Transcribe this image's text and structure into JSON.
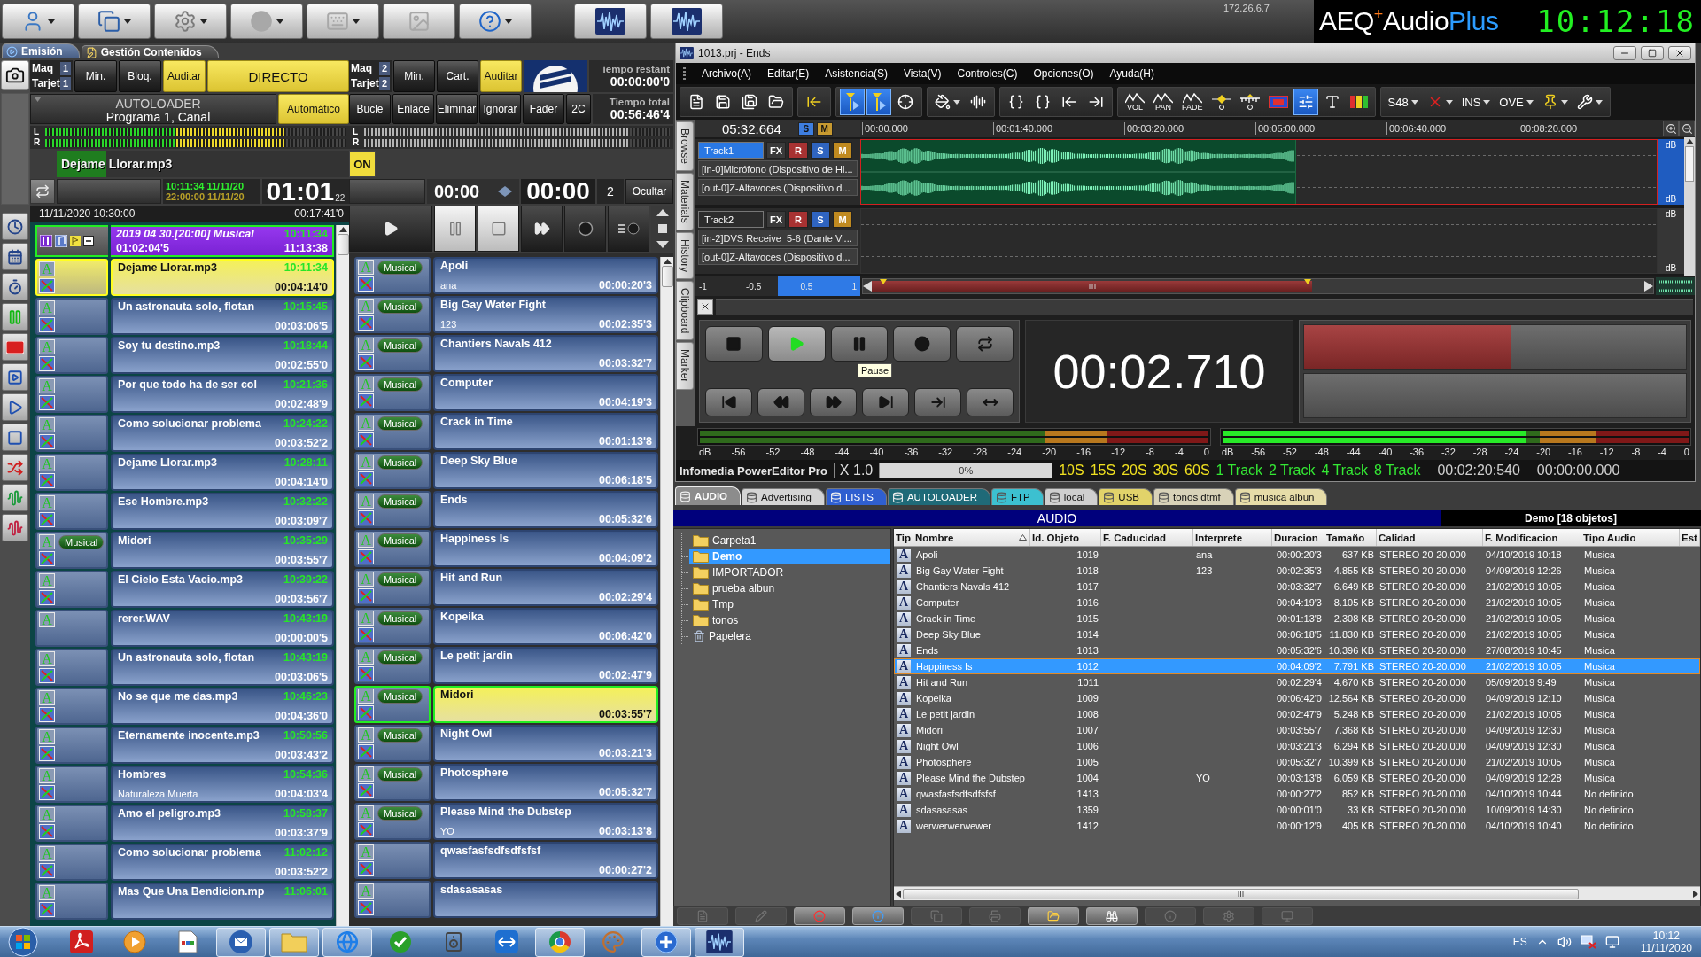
{
  "top_bar": {
    "buttons": [
      {
        "kind": "user",
        "disabled": false
      },
      {
        "kind": "windows",
        "disabled": false
      },
      {
        "kind": "gear",
        "disabled": false
      },
      {
        "kind": "disc",
        "disabled": true
      },
      {
        "kind": "grid",
        "disabled": true
      },
      {
        "kind": "figures",
        "disabled": true
      },
      {
        "kind": "help",
        "disabled": false
      }
    ],
    "ip_address": "172.26.6.7",
    "logo": {
      "company": "AEQ",
      "plus": "+",
      "product": "Audio",
      "edition": "Plus"
    },
    "clock": "10:12:18"
  },
  "main_tabs": [
    {
      "label": "Emisión",
      "selected": true
    },
    {
      "label": "Gestión Contenidos",
      "selected": false
    }
  ],
  "player_1": {
    "machine_label": "Maq",
    "machine": "1",
    "card_label": "Tarjet",
    "card": "1",
    "buttons": [
      {
        "label": "Min.",
        "on": false
      },
      {
        "label": "Bloq.",
        "on": false
      },
      {
        "label": "Auditar",
        "on": true
      },
      {
        "label": "DIRECTO",
        "on": true
      }
    ],
    "source": {
      "title": "AUTOLOADER",
      "subtitle": "Programa 1, Canal"
    },
    "mode": {
      "label": "Automático",
      "on": true
    },
    "meters": [
      {
        "channel": "L",
        "level": 0.8,
        "active": true
      },
      {
        "channel": "R",
        "level": 0.8,
        "active": true
      }
    ],
    "now_playing": {
      "title": "Dejame Llorar.mp3",
      "level": 0.17
    },
    "clock_start": "10:11:34 11/11/20",
    "clock_end": "22:00:00 11/11/20",
    "countdown": "01:01",
    "countdown_fraction": "22",
    "list_date": "11/11/2020 10:30:00",
    "list_total": "00:17:41'0",
    "block": {
      "title": "2019 04 30.[20:00] Musical",
      "start": "10:11:34",
      "length": "01:02:04'5",
      "end": "11:13:38"
    },
    "items": [
      {
        "type": "A",
        "title": "Dejame Llorar.mp3",
        "time": "10:11:34",
        "duration": "00:04:14'0",
        "transition": true,
        "selected": true
      },
      {
        "type": "A",
        "title": "Un astronauta solo, flotan",
        "time": "10:15:45",
        "duration": "00:03:06'5",
        "transition": true,
        "selected": false
      },
      {
        "type": "A",
        "title": "Soy tu destino.mp3",
        "time": "10:18:44",
        "duration": "00:02:55'0",
        "transition": true,
        "selected": false
      },
      {
        "type": "A",
        "title": "Por que todo ha de ser col",
        "time": "10:21:36",
        "duration": "00:02:48'9",
        "transition": true,
        "selected": false
      },
      {
        "type": "A",
        "title": "Como solucionar problema",
        "time": "10:24:22",
        "duration": "00:03:52'2",
        "transition": true,
        "selected": false
      },
      {
        "type": "A",
        "title": "Dejame Llorar.mp3",
        "time": "10:28:11",
        "duration": "00:04:14'0",
        "transition": true,
        "selected": false
      },
      {
        "type": "A",
        "title": "Ese Hombre.mp3",
        "time": "10:32:22",
        "duration": "00:03:09'7",
        "transition": true,
        "selected": false
      },
      {
        "type": "A",
        "title": "Midori",
        "tag": "Musical",
        "time": "10:35:29",
        "duration": "00:03:55'7",
        "transition": true,
        "selected": false
      },
      {
        "type": "A",
        "title": "El Cielo Esta Vacio.mp3",
        "time": "10:39:22",
        "duration": "00:03:56'7",
        "transition": true,
        "selected": false
      },
      {
        "type": "A",
        "title": "rerer.WAV",
        "time": "10:43:19",
        "duration": "00:00:00'5",
        "transition": false,
        "selected": false
      },
      {
        "type": "A",
        "title": "Un astronauta solo, flotan",
        "time": "10:43:19",
        "duration": "00:03:06'5",
        "transition": true,
        "selected": false
      },
      {
        "type": "A",
        "title": "No se que me das.mp3",
        "time": "10:46:23",
        "duration": "00:04:36'0",
        "transition": true,
        "selected": false
      },
      {
        "type": "A",
        "title": "Eternamente inocente.mp3",
        "time": "10:50:56",
        "duration": "00:03:43'2",
        "transition": true,
        "selected": false
      },
      {
        "type": "A",
        "title": "Hombres",
        "subtitle": "Naturaleza Muerta",
        "time": "10:54:36",
        "duration": "00:04:03'4",
        "transition": true,
        "selected": false
      },
      {
        "type": "A",
        "title": "Amo el peligro.mp3",
        "time": "10:58:37",
        "duration": "00:03:37'9",
        "transition": true,
        "selected": false
      },
      {
        "type": "A",
        "title": "Como solucionar problema",
        "time": "11:02:12",
        "duration": "00:03:52'2",
        "transition": true,
        "selected": false
      },
      {
        "type": "A",
        "title": "Mas Que Una Bendicion.mp",
        "time": "11:06:01",
        "transition": true,
        "selected": false
      }
    ]
  },
  "player_2": {
    "machine_label": "Maq",
    "machine": "2",
    "card_label": "Tarjet",
    "card": "2",
    "buttons": [
      {
        "label": "Min.",
        "on": false
      },
      {
        "label": "Cart.",
        "on": false
      },
      {
        "label": "Auditar",
        "on": true
      }
    ],
    "remaining_label": "iempo restant",
    "remaining": "00:00:00'0",
    "options": [
      {
        "label": "Bucle",
        "on": false
      },
      {
        "label": "Enlace",
        "on": false
      },
      {
        "label": "Eliminar",
        "on": false
      },
      {
        "label": "Ignorar",
        "on": false
      },
      {
        "label": "Fader",
        "on": false
      },
      {
        "label": "2C",
        "on": false
      }
    ],
    "total_label": "Tiempo total",
    "total": "00:56:46'4",
    "meters": [
      {
        "channel": "L",
        "level": 0.87,
        "active": false
      },
      {
        "channel": "R",
        "level": 0.87,
        "active": false
      }
    ],
    "on_air": {
      "label": "ON",
      "on": true
    },
    "position": "00:00",
    "remaining_time": "00:00",
    "count": "2",
    "hide_label": "Ocultar",
    "transport": [
      {
        "kind": "play",
        "on": false
      },
      {
        "kind": "pause",
        "on": true
      },
      {
        "kind": "stop",
        "on": true
      },
      {
        "kind": "forward",
        "on": false
      },
      {
        "kind": "record",
        "on": false
      },
      {
        "kind": "cue_record",
        "on": false
      }
    ],
    "items": [
      {
        "type": "A",
        "tag": "Musical",
        "title": "Apoli",
        "subtitle": "ana",
        "duration": "00:00:20'3",
        "transition": true,
        "selected": false
      },
      {
        "type": "A",
        "tag": "Musical",
        "title": "Big Gay Water Fight",
        "subtitle": "123",
        "duration": "00:02:35'3",
        "transition": true,
        "selected": false
      },
      {
        "type": "A",
        "tag": "Musical",
        "title": "Chantiers Navals 412",
        "duration": "00:03:32'7",
        "transition": true,
        "selected": false
      },
      {
        "type": "A",
        "tag": "Musical",
        "title": "Computer",
        "duration": "00:04:19'3",
        "transition": true,
        "selected": false
      },
      {
        "type": "A",
        "tag": "Musical",
        "title": "Crack in Time",
        "duration": "00:01:13'8",
        "transition": true,
        "selected": false
      },
      {
        "type": "A",
        "tag": "Musical",
        "title": "Deep Sky Blue",
        "duration": "00:06:18'5",
        "transition": true,
        "selected": false
      },
      {
        "type": "A",
        "tag": "Musical",
        "title": "Ends",
        "duration": "00:05:32'6",
        "transition": true,
        "selected": false
      },
      {
        "type": "A",
        "tag": "Musical",
        "title": "Happiness Is",
        "duration": "00:04:09'2",
        "transition": true,
        "selected": false
      },
      {
        "type": "A",
        "tag": "Musical",
        "title": "Hit and Run",
        "duration": "00:02:29'4",
        "transition": true,
        "selected": false
      },
      {
        "type": "A",
        "tag": "Musical",
        "title": "Kopeika",
        "duration": "00:06:42'0",
        "transition": true,
        "selected": false
      },
      {
        "type": "A",
        "tag": "Musical",
        "title": "Le petit jardin",
        "duration": "00:02:47'9",
        "transition": true,
        "selected": false
      },
      {
        "type": "A",
        "tag": "Musical",
        "title": "Midori",
        "duration": "00:03:55'7",
        "transition": true,
        "selected": true
      },
      {
        "type": "A",
        "tag": "Musical",
        "title": "Night Owl",
        "duration": "00:03:21'3",
        "transition": true,
        "selected": false
      },
      {
        "type": "A",
        "tag": "Musical",
        "title": "Photosphere",
        "duration": "00:05:32'7",
        "transition": true,
        "selected": false
      },
      {
        "type": "A",
        "tag": "Musical",
        "title": "Please Mind the Dubstep",
        "subtitle": "YO",
        "duration": "00:03:13'8",
        "transition": true,
        "selected": false
      },
      {
        "type": "A",
        "title": "qwasfasfsdfsdfsfsf",
        "duration": "00:00:27'2",
        "transition": true,
        "selected": false
      },
      {
        "type": "A",
        "title": "sdasasasas",
        "transition": true,
        "selected": false
      }
    ]
  },
  "editor": {
    "title": "1013.prj - Ends",
    "menu": [
      "Archivo(A)",
      "Editar(E)",
      "Asistencia(S)",
      "Vista(V)",
      "Controles(C)",
      "Opciones(O)",
      "Ayuda(H)"
    ],
    "toolbar": [
      [
        {
          "kind": "new",
          "selected": false
        },
        {
          "kind": "save",
          "selected": false
        },
        {
          "kind": "save_all",
          "selected": false
        },
        {
          "kind": "open",
          "selected": false
        }
      ],
      [
        {
          "kind": "insert",
          "selected": false
        }
      ],
      [
        {
          "kind": "mark_start",
          "selected": true
        },
        {
          "kind": "mark_end",
          "selected": true
        },
        {
          "kind": "move",
          "selected": false
        }
      ],
      [
        {
          "kind": "fill",
          "selected": false
        },
        {
          "kind": "normalize",
          "selected": false
        }
      ],
      [
        {
          "kind": "brace_left",
          "selected": false
        },
        {
          "kind": "brace_right",
          "selected": false
        },
        {
          "kind": "jump_left",
          "selected": false
        },
        {
          "kind": "jump_right",
          "selected": false
        }
      ],
      [
        {
          "kind": "envelope",
          "label": "VOL",
          "selected": false
        },
        {
          "kind": "envelope",
          "label": "PAN",
          "selected": false
        },
        {
          "kind": "envelope",
          "label": "FADE",
          "selected": false
        },
        {
          "kind": "gain_point",
          "selected": false
        },
        {
          "kind": "gain_ruler",
          "selected": false
        },
        {
          "kind": "region",
          "selected": false
        },
        {
          "kind": "slider",
          "selected": true
        },
        {
          "kind": "text",
          "selected": false
        },
        {
          "kind": "level_bars",
          "selected": false
        }
      ],
      [
        {
          "kind": "dropdown",
          "label": "S48",
          "selected": false
        },
        {
          "kind": "cut",
          "selected": false
        },
        {
          "kind": "dropdown",
          "label": "INS",
          "selected": false
        },
        {
          "kind": "dropdown",
          "label": "OVE",
          "selected": false
        },
        {
          "kind": "marker",
          "selected": false
        },
        {
          "kind": "wrench",
          "selected": false
        }
      ]
    ],
    "position": "05:32.664",
    "solo_label": "S",
    "mute_label": "M",
    "ruler": [
      "00:00.000",
      "00:01:40.000",
      "00:03:20.000",
      "00:05:00.000",
      "00:06:40.000",
      "00:08:20.000"
    ],
    "side_tabs": [
      "Browse",
      "Materials",
      "History",
      "Clipboard",
      "Marker"
    ],
    "tracks": [
      {
        "name": "Track1",
        "selected": true,
        "buttons": [
          {
            "kind": "fx",
            "label": "FX"
          },
          {
            "kind": "record",
            "label": "R"
          },
          {
            "kind": "solo",
            "label": "S"
          },
          {
            "kind": "mute",
            "label": "M"
          }
        ],
        "input": "[in-0]Micrófono (Dispositivo de Hi...",
        "output": "[out-0]Z-Altavoces (Dispositivo d...",
        "scale": [
          "dB",
          "dB"
        ],
        "clip": true
      },
      {
        "name": "Track2",
        "selected": false,
        "buttons": [
          {
            "kind": "fx",
            "label": "FX"
          },
          {
            "kind": "record",
            "label": "R"
          },
          {
            "kind": "solo",
            "label": "S"
          },
          {
            "kind": "mute",
            "label": "M"
          }
        ],
        "input": "[in-2]DVS Receive  5-6 (Dante Vi...",
        "output": "[out-0]Z-Altavoces (Dispositivo d...",
        "scale": [
          "dB",
          "dB"
        ],
        "clip": false
      }
    ],
    "zoom_scale": [
      "-1",
      "-0.5",
      "0.5",
      "1"
    ],
    "transport_top": [
      {
        "kind": "stop",
        "on": false
      },
      {
        "kind": "play",
        "on": true
      },
      {
        "kind": "pause",
        "on": false
      },
      {
        "kind": "record",
        "on": false
      },
      {
        "kind": "loop",
        "on": false
      }
    ],
    "transport_bottom": [
      {
        "kind": "start",
        "on": false
      },
      {
        "kind": "rewind",
        "on": false
      },
      {
        "kind": "forward",
        "on": false
      },
      {
        "kind": "end",
        "on": false
      },
      {
        "kind": "in_out",
        "on": false
      },
      {
        "kind": "span",
        "on": false
      }
    ],
    "tooltip": "Pause",
    "time": "00:02.710",
    "output_levels": [
      {
        "level": 0.54
      },
      {
        "level": 0
      }
    ],
    "meters": [
      {
        "channels": [
          {
            "level": 0
          },
          {
            "level": 0
          }
        ],
        "scale": [
          "dB",
          "-56",
          "-52",
          "-48",
          "-44",
          "-40",
          "-36",
          "-32",
          "-28",
          "-24",
          "-20",
          "-16",
          "-12",
          "-8",
          "-4",
          "0"
        ]
      },
      {
        "channels": [
          {
            "level": 0.65
          },
          {
            "level": 0.65
          }
        ],
        "scale": [
          "dB",
          "-56",
          "-52",
          "-48",
          "-44",
          "-40",
          "-36",
          "-32",
          "-28",
          "-24",
          "-20",
          "-16",
          "-12",
          "-8",
          "-4",
          "0"
        ]
      }
    ],
    "status": {
      "app": "Infomedia PowerEditor Pro",
      "zoom": "X 1.0",
      "progress": {
        "label": "0%",
        "level": 0
      },
      "spans": [
        "10S",
        "15S",
        "20S",
        "30S",
        "60S"
      ],
      "track_modes": [
        "1 Track",
        "2 Track",
        "4 Track",
        "8 Track"
      ],
      "length": "00:02:20:540",
      "cursor": "00:00:00.000"
    }
  },
  "browser": {
    "tabs": [
      {
        "label": "AUDIO",
        "selected": true,
        "color": "#8c8c8c"
      },
      {
        "label": "Advertising",
        "selected": false,
        "color": "#d4d4d4"
      },
      {
        "label": "LISTS",
        "selected": false,
        "color": "#2f5fd0"
      },
      {
        "label": "AUTOLOADER",
        "selected": false,
        "color": "#1f6a78"
      },
      {
        "label": "FTP",
        "selected": false,
        "color": "#3cc0d0"
      },
      {
        "label": "local",
        "selected": false,
        "color": "#cfcfcf"
      },
      {
        "label": "USB",
        "selected": false,
        "color": "#e2d36a"
      },
      {
        "label": "tonos dtmf",
        "selected": false,
        "color": "#d8d2b8"
      },
      {
        "label": "musica albun",
        "selected": false,
        "color": "#e6dca8"
      }
    ],
    "title": "AUDIO",
    "summary": "Demo [18 objetos]",
    "folders": [
      {
        "name": "Carpeta1",
        "kind": "folder",
        "selected": false
      },
      {
        "name": "Demo",
        "kind": "folder",
        "selected": true
      },
      {
        "name": "IMPORTADOR",
        "kind": "folder",
        "selected": false
      },
      {
        "name": "prueba albun",
        "kind": "folder",
        "selected": false
      },
      {
        "name": "Tmp",
        "kind": "folder",
        "selected": false
      },
      {
        "name": "tonos",
        "kind": "folder",
        "selected": false
      },
      {
        "name": "Papelera",
        "kind": "trash",
        "selected": false
      }
    ],
    "columns": [
      {
        "label": "Tip",
        "sorted": false
      },
      {
        "label": "Nombre",
        "sorted": true
      },
      {
        "label": "Id. Objeto",
        "sorted": false
      },
      {
        "label": "F. Caducidad",
        "sorted": false
      },
      {
        "label": "Interprete",
        "sorted": false
      },
      {
        "label": "Duracion",
        "sorted": false
      },
      {
        "label": "Tamaño",
        "sorted": false
      },
      {
        "label": "Calidad",
        "sorted": false
      },
      {
        "label": "F. Modificacion",
        "sorted": false
      },
      {
        "label": "Tipo Audio",
        "sorted": false
      },
      {
        "label": "Est",
        "sorted": false
      }
    ],
    "rows": [
      {
        "type": "A",
        "name": "Apoli",
        "id": "1019",
        "artist": "ana",
        "duration": "00:00:20'3",
        "size": "637 KB",
        "quality": "STEREO 20-20.000",
        "modified": "04/10/2019 10:18",
        "audio_type": "Musica",
        "selected": false
      },
      {
        "type": "A",
        "name": "Big Gay Water Fight",
        "id": "1018",
        "artist": "123",
        "duration": "00:02:35'3",
        "size": "4.855 KB",
        "quality": "STEREO 20-20.000",
        "modified": "04/09/2019 12:26",
        "audio_type": "Musica",
        "selected": false
      },
      {
        "type": "A",
        "name": "Chantiers Navals 412",
        "id": "1017",
        "duration": "00:03:32'7",
        "size": "6.649 KB",
        "quality": "STEREO 20-20.000",
        "modified": "21/02/2019 10:05",
        "audio_type": "Musica",
        "selected": false
      },
      {
        "type": "A",
        "name": "Computer",
        "id": "1016",
        "duration": "00:04:19'3",
        "size": "8.105 KB",
        "quality": "STEREO 20-20.000",
        "modified": "21/02/2019 10:05",
        "audio_type": "Musica",
        "selected": false
      },
      {
        "type": "A",
        "name": "Crack in Time",
        "id": "1015",
        "duration": "00:01:13'8",
        "size": "2.308 KB",
        "quality": "STEREO 20-20.000",
        "modified": "21/02/2019 10:05",
        "audio_type": "Musica",
        "selected": false
      },
      {
        "type": "A",
        "name": "Deep Sky Blue",
        "id": "1014",
        "duration": "00:06:18'5",
        "size": "11.830 KB",
        "quality": "STEREO 20-20.000",
        "modified": "21/02/2019 10:05",
        "audio_type": "Musica",
        "selected": false
      },
      {
        "type": "A",
        "name": "Ends",
        "id": "1013",
        "duration": "00:05:32'6",
        "size": "10.396 KB",
        "quality": "STEREO 20-20.000",
        "modified": "27/08/2019 10:45",
        "audio_type": "Musica",
        "selected": false
      },
      {
        "type": "A",
        "name": "Happiness Is",
        "id": "1012",
        "duration": "00:04:09'2",
        "size": "7.791 KB",
        "quality": "STEREO 20-20.000",
        "modified": "21/02/2019 10:05",
        "audio_type": "Musica",
        "selected": true
      },
      {
        "type": "A",
        "name": "Hit and Run",
        "id": "1011",
        "duration": "00:02:29'4",
        "size": "4.670 KB",
        "quality": "STEREO 20-20.000",
        "modified": "05/09/2019 9:49",
        "audio_type": "Musica",
        "selected": false
      },
      {
        "type": "A",
        "name": "Kopeika",
        "id": "1009",
        "duration": "00:06:42'0",
        "size": "12.564 KB",
        "quality": "STEREO 20-20.000",
        "modified": "04/09/2019 12:10",
        "audio_type": "Musica",
        "selected": false
      },
      {
        "type": "A",
        "name": "Le petit jardin",
        "id": "1008",
        "duration": "00:02:47'9",
        "size": "5.248 KB",
        "quality": "STEREO 20-20.000",
        "modified": "21/02/2019 10:05",
        "audio_type": "Musica",
        "selected": false
      },
      {
        "type": "A",
        "name": "Midori",
        "id": "1007",
        "duration": "00:03:55'7",
        "size": "7.368 KB",
        "quality": "STEREO 20-20.000",
        "modified": "04/09/2019 12:30",
        "audio_type": "Musica",
        "selected": false
      },
      {
        "type": "A",
        "name": "Night Owl",
        "id": "1006",
        "duration": "00:03:21'3",
        "size": "6.294 KB",
        "quality": "STEREO 20-20.000",
        "modified": "04/09/2019 12:30",
        "audio_type": "Musica",
        "selected": false
      },
      {
        "type": "A",
        "name": "Photosphere",
        "id": "1005",
        "duration": "00:05:32'7",
        "size": "10.399 KB",
        "quality": "STEREO 20-20.000",
        "modified": "21/02/2019 10:05",
        "audio_type": "Musica",
        "selected": false
      },
      {
        "type": "A",
        "name": "Please Mind the Dubstep",
        "id": "1004",
        "artist": "YO",
        "duration": "00:03:13'8",
        "size": "6.059 KB",
        "quality": "STEREO 20-20.000",
        "modified": "04/09/2019 12:28",
        "audio_type": "Musica",
        "selected": false
      },
      {
        "type": "A",
        "name": "qwasfasfsdfsdfsfsf",
        "id": "1413",
        "duration": "00:00:27'2",
        "size": "852 KB",
        "quality": "STEREO 20-20.000",
        "modified": "04/10/2019 10:44",
        "audio_type": "No definido",
        "selected": false
      },
      {
        "type": "A",
        "name": "sdasasasas",
        "id": "1359",
        "duration": "00:00:01'0",
        "size": "33 KB",
        "quality": "STEREO 20-20.000",
        "modified": "10/09/2019 14:30",
        "audio_type": "No definido",
        "selected": false
      },
      {
        "type": "A",
        "name": "werwerwerwewer",
        "id": "1412",
        "duration": "00:00:12'9",
        "size": "405 KB",
        "quality": "STEREO 20-20.000",
        "modified": "04/10/2019 10:40",
        "audio_type": "No definido",
        "selected": false
      }
    ],
    "tools": [
      {
        "kind": "document",
        "disabled": true
      },
      {
        "kind": "pencil",
        "disabled": true
      },
      {
        "kind": "stop",
        "disabled": false
      },
      {
        "kind": "info",
        "disabled": false
      },
      {
        "kind": "copy",
        "disabled": true
      },
      {
        "kind": "print",
        "disabled": true
      },
      {
        "kind": "folder",
        "disabled": false
      },
      {
        "kind": "binoculars",
        "disabled": false
      },
      {
        "kind": "about",
        "disabled": true
      },
      {
        "kind": "settings",
        "disabled": true
      },
      {
        "kind": "monitor",
        "disabled": true
      }
    ]
  },
  "taskbar": {
    "apps": [
      {
        "kind": "pdf",
        "running": false
      },
      {
        "kind": "media",
        "running": false
      },
      {
        "kind": "document",
        "running": false
      },
      {
        "kind": "mail",
        "running": true
      },
      {
        "kind": "explorer",
        "running": true
      },
      {
        "kind": "browser_e",
        "running": true
      },
      {
        "kind": "check",
        "running": false
      },
      {
        "kind": "speaker",
        "running": false
      },
      {
        "kind": "remote",
        "running": false
      },
      {
        "kind": "chrome",
        "running": true
      },
      {
        "kind": "paint",
        "running": false
      },
      {
        "kind": "plus",
        "running": true
      },
      {
        "kind": "waveform",
        "running": true
      }
    ],
    "language": "ES",
    "time": "10:12",
    "date": "11/11/2020"
  }
}
